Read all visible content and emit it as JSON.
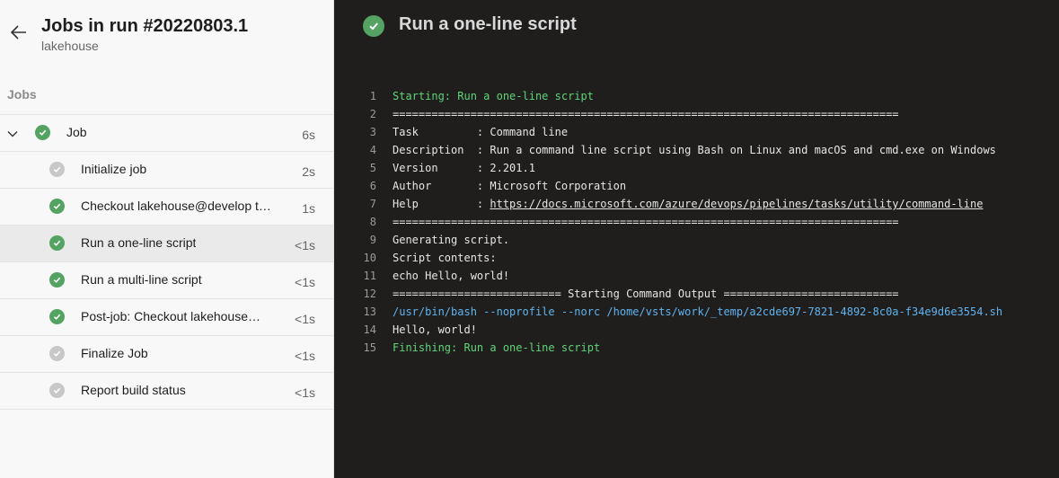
{
  "header": {
    "title": "Jobs in run #20220803.1",
    "subtitle": "lakehouse"
  },
  "jobs_label": "Jobs",
  "job": {
    "label": "Job",
    "duration": "6s",
    "status": "success"
  },
  "steps": [
    {
      "label": "Initialize job",
      "duration": "2s",
      "status": "skipped"
    },
    {
      "label": "Checkout lakehouse@develop to s",
      "duration": "1s",
      "status": "success"
    },
    {
      "label": "Run a one-line script",
      "duration": "<1s",
      "status": "success",
      "selected": true
    },
    {
      "label": "Run a multi-line script",
      "duration": "<1s",
      "status": "success"
    },
    {
      "label": "Post-job: Checkout lakehouse…",
      "duration": "<1s",
      "status": "success"
    },
    {
      "label": "Finalize Job",
      "duration": "<1s",
      "status": "skipped"
    },
    {
      "label": "Report build status",
      "duration": "<1s",
      "status": "skipped"
    }
  ],
  "main": {
    "title": "Run a one-line script"
  },
  "log": [
    {
      "n": "1",
      "text": "Starting: Run a one-line script",
      "color": "green"
    },
    {
      "n": "2",
      "text": "=============================================================================="
    },
    {
      "n": "3",
      "text": "Task         : Command line"
    },
    {
      "n": "4",
      "text": "Description  : Run a command line script using Bash on Linux and macOS and cmd.exe on Windows"
    },
    {
      "n": "5",
      "text": "Version      : 2.201.1"
    },
    {
      "n": "6",
      "text": "Author       : Microsoft Corporation"
    },
    {
      "n": "7",
      "text": "Help         : ",
      "link": "https://docs.microsoft.com/azure/devops/pipelines/tasks/utility/command-line"
    },
    {
      "n": "8",
      "text": "=============================================================================="
    },
    {
      "n": "9",
      "text": "Generating script."
    },
    {
      "n": "10",
      "text": "Script contents:"
    },
    {
      "n": "11",
      "text": "echo Hello, world!"
    },
    {
      "n": "12",
      "text": "========================== Starting Command Output ==========================="
    },
    {
      "n": "13",
      "text": "/usr/bin/bash --noprofile --norc /home/vsts/work/_temp/a2cde697-7821-4892-8c0a-f34e9d6e3554.sh",
      "color": "blue"
    },
    {
      "n": "14",
      "text": "Hello, world!"
    },
    {
      "n": "15",
      "text": "Finishing: Run a one-line script",
      "color": "green"
    }
  ],
  "colors": {
    "success": "#55a362",
    "skipped": "#c8c8c8",
    "log_green": "#5fd47a",
    "log_blue": "#5fb3f0",
    "console_bg": "#1f1e1d"
  },
  "icons": {
    "back": "arrow-left-icon",
    "expand": "chevron-down-icon",
    "status": "check-circle-icon"
  }
}
